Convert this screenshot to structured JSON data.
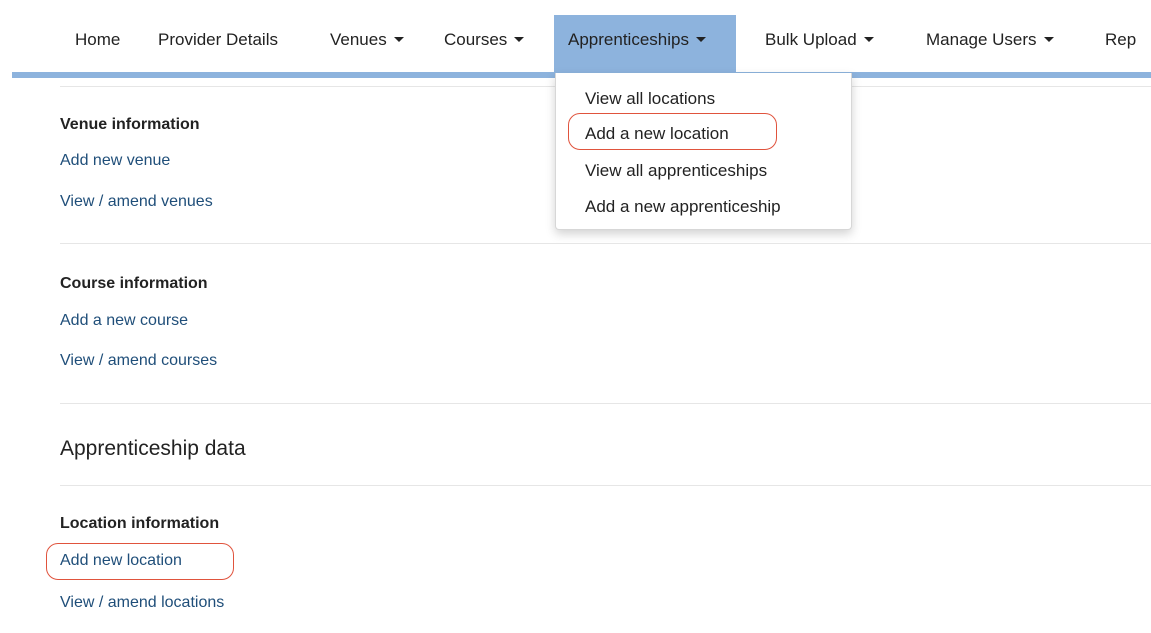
{
  "nav": {
    "items": [
      {
        "label": "Home",
        "dropdown": false
      },
      {
        "label": "Provider Details",
        "dropdown": false
      },
      {
        "label": "Venues",
        "dropdown": true
      },
      {
        "label": "Courses",
        "dropdown": true
      },
      {
        "label": "Apprenticeships",
        "dropdown": true,
        "active": true
      },
      {
        "label": "Bulk Upload",
        "dropdown": true
      },
      {
        "label": "Manage Users",
        "dropdown": true
      },
      {
        "label": "Rep",
        "dropdown": false
      }
    ],
    "active_color": "#8db3dd"
  },
  "dropdown": {
    "items": [
      {
        "label": "View all locations"
      },
      {
        "label": "Add a new location",
        "highlighted": true
      },
      {
        "label": "View all apprenticeships"
      },
      {
        "label": "Add a new apprenticeship"
      }
    ]
  },
  "venue": {
    "heading": "Venue information",
    "links": [
      "Add new venue",
      "View / amend venues"
    ]
  },
  "course": {
    "heading": "Course information",
    "links": [
      "Add a new course",
      "View / amend courses"
    ]
  },
  "apprenticeship": {
    "title": "Apprenticeship data"
  },
  "location": {
    "heading": "Location information",
    "links": [
      "Add new location",
      "View / amend locations"
    ]
  },
  "colors": {
    "link": "#1f4e79",
    "highlight": "#e0533d",
    "nav_rule": "#8db3dd"
  }
}
